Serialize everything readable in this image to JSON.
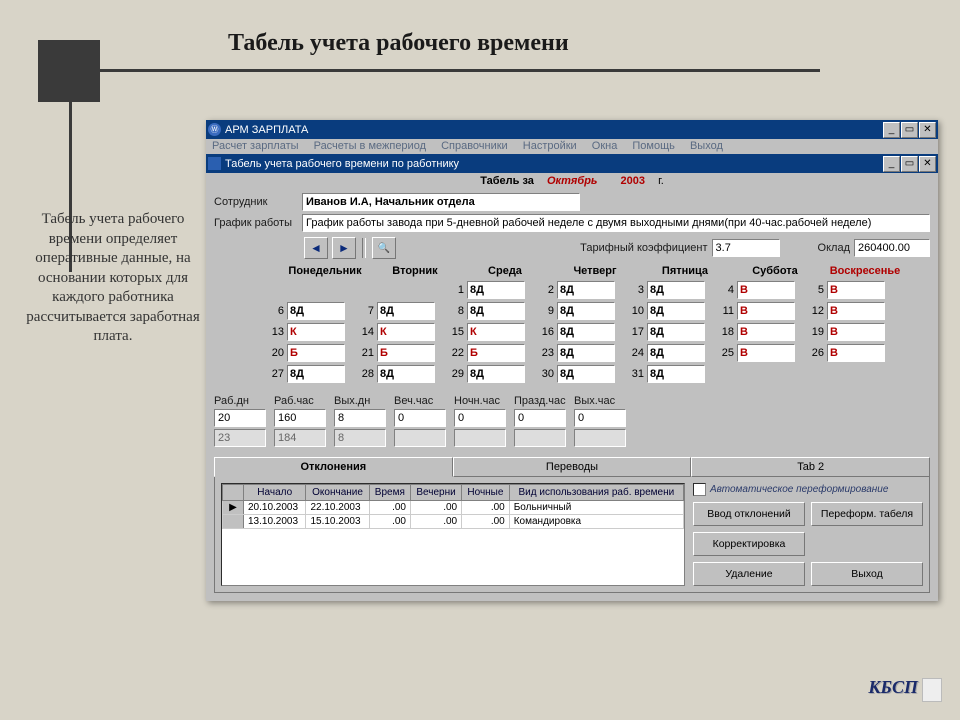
{
  "slide": {
    "title": "Табель учета рабочего времени",
    "desc": "Табель учета рабочего времени определяет оперативные данные, на основании которых для каждого работника рассчитывается заработная плата."
  },
  "outer": {
    "title": "АРМ ЗАРПЛАТА"
  },
  "menu": [
    "Расчет зарплаты",
    "Расчеты в межпериод",
    "Справочники",
    "Настройки",
    "Окна",
    "Помощь",
    "Выход"
  ],
  "doc": {
    "title": "Табель учета рабочего времени по работнику"
  },
  "period": {
    "label": "Табель за",
    "month": "Октябрь",
    "year": "2003",
    "suffix": "г."
  },
  "employee": {
    "label": "Сотрудник",
    "value": "Иванов И.А,   Начальник отдела"
  },
  "schedule": {
    "label": "График работы",
    "value": "График работы завода при 5-дневной рабочей неделе с двумя выходными днями(при 40-час.рабочей неделе)"
  },
  "coef": {
    "label": "Тарифный коэффициент",
    "value": "3.7"
  },
  "oklad": {
    "label": "Оклад",
    "value": "260400.00"
  },
  "dow": [
    "Понедельник",
    "Вторник",
    "Среда",
    "Четверг",
    "Пятница",
    "Суббота",
    "Воскресенье"
  ],
  "days": [
    [
      null,
      null,
      {
        "n": "1",
        "c": "8Д"
      },
      {
        "n": "2",
        "c": "8Д"
      },
      {
        "n": "3",
        "c": "8Д"
      },
      {
        "n": "4",
        "c": "В",
        "r": true
      },
      {
        "n": "5",
        "c": "В",
        "r": true
      }
    ],
    [
      {
        "n": "6",
        "c": "8Д"
      },
      {
        "n": "7",
        "c": "8Д"
      },
      {
        "n": "8",
        "c": "8Д"
      },
      {
        "n": "9",
        "c": "8Д"
      },
      {
        "n": "10",
        "c": "8Д"
      },
      {
        "n": "11",
        "c": "В",
        "r": true
      },
      {
        "n": "12",
        "c": "В",
        "r": true
      }
    ],
    [
      {
        "n": "13",
        "c": "К",
        "r": true
      },
      {
        "n": "14",
        "c": "К",
        "r": true
      },
      {
        "n": "15",
        "c": "К",
        "r": true
      },
      {
        "n": "16",
        "c": "8Д"
      },
      {
        "n": "17",
        "c": "8Д"
      },
      {
        "n": "18",
        "c": "В",
        "r": true
      },
      {
        "n": "19",
        "c": "В",
        "r": true
      }
    ],
    [
      {
        "n": "20",
        "c": "Б",
        "r": true
      },
      {
        "n": "21",
        "c": "Б",
        "r": true
      },
      {
        "n": "22",
        "c": "Б",
        "r": true
      },
      {
        "n": "23",
        "c": "8Д"
      },
      {
        "n": "24",
        "c": "8Д"
      },
      {
        "n": "25",
        "c": "В",
        "r": true
      },
      {
        "n": "26",
        "c": "В",
        "r": true
      }
    ],
    [
      {
        "n": "27",
        "c": "8Д"
      },
      {
        "n": "28",
        "c": "8Д"
      },
      {
        "n": "29",
        "c": "8Д"
      },
      {
        "n": "30",
        "c": "8Д"
      },
      {
        "n": "31",
        "c": "8Д"
      },
      null,
      null
    ]
  ],
  "totals": {
    "cols": [
      {
        "label": "Раб.дн",
        "v1": "20",
        "v2": "23"
      },
      {
        "label": "Раб.час",
        "v1": "160",
        "v2": "184"
      },
      {
        "label": "Вых.дн",
        "v1": "8",
        "v2": "8"
      },
      {
        "label": "Веч.час",
        "v1": "0",
        "v2": ""
      },
      {
        "label": "Ночн.час",
        "v1": "0",
        "v2": ""
      },
      {
        "label": "Празд.час",
        "v1": "0",
        "v2": ""
      },
      {
        "label": "Вых.час",
        "v1": "0",
        "v2": ""
      }
    ]
  },
  "tabs": [
    "Отклонения",
    "Переводы",
    "Tab 2"
  ],
  "dev_table": {
    "headers": [
      "Начало",
      "Окончание",
      "Время",
      "Вечерни",
      "Ночные",
      "Вид использования раб. времени"
    ],
    "rows": [
      [
        "20.10.2003",
        "22.10.2003",
        ".00",
        ".00",
        ".00",
        "Больничный"
      ],
      [
        "13.10.2003",
        "15.10.2003",
        ".00",
        ".00",
        ".00",
        "Командировка"
      ]
    ]
  },
  "auto_chk": "Автоматическое переформирование",
  "buttons": {
    "b1": "Ввод отклонений",
    "b2": "Переформ. табеля",
    "b3": "Корректировка",
    "b4": "Удаление",
    "b5": "Выход"
  },
  "footer": "КБСП"
}
